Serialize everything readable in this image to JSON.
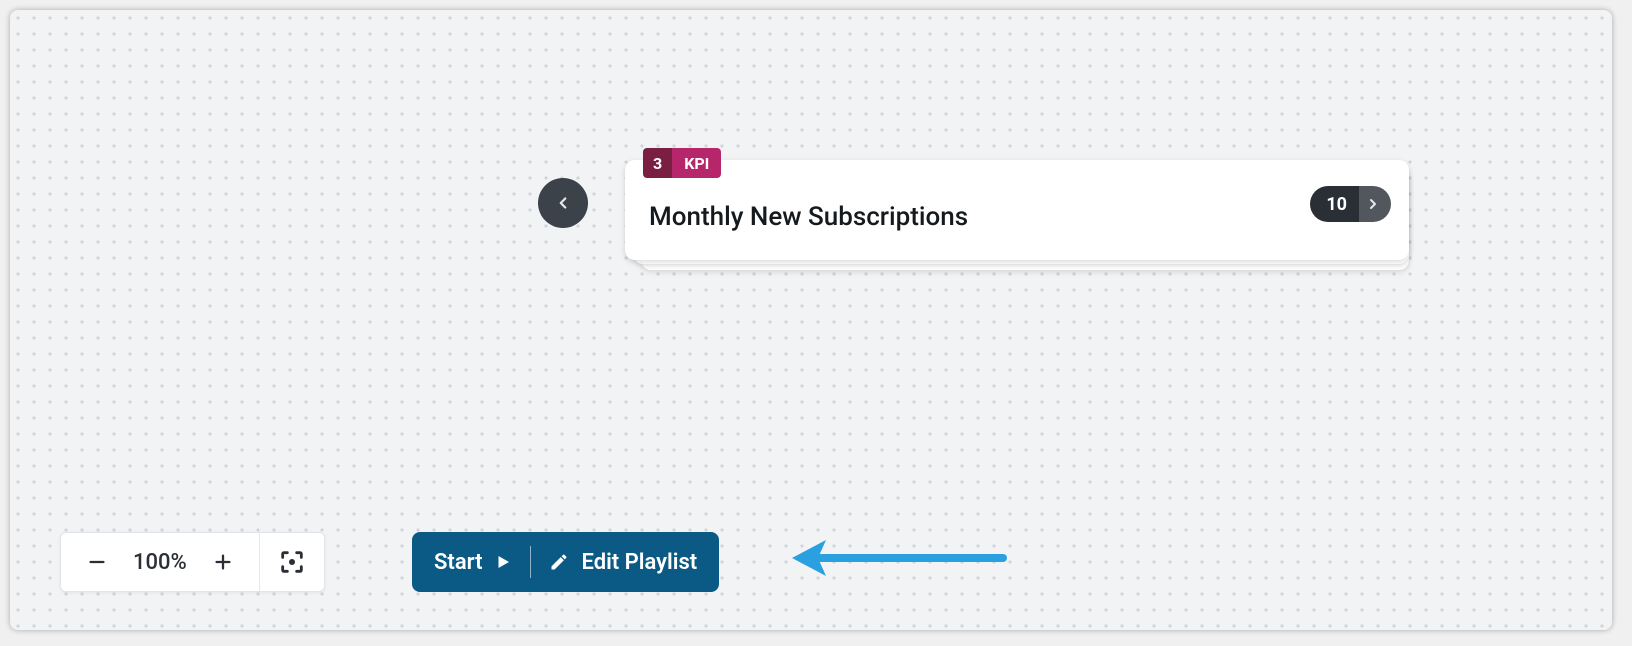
{
  "card": {
    "index": "3",
    "type_label": "KPI",
    "title": "Monthly New Subscriptions",
    "total": "10"
  },
  "zoom": {
    "level": "100%"
  },
  "actions": {
    "start_label": "Start",
    "edit_label": "Edit Playlist"
  },
  "colors": {
    "action_bg": "#0b5a85",
    "tag_dark": "#7a1f42",
    "tag_light": "#b6266a",
    "arrow": "#2aa0e0"
  }
}
